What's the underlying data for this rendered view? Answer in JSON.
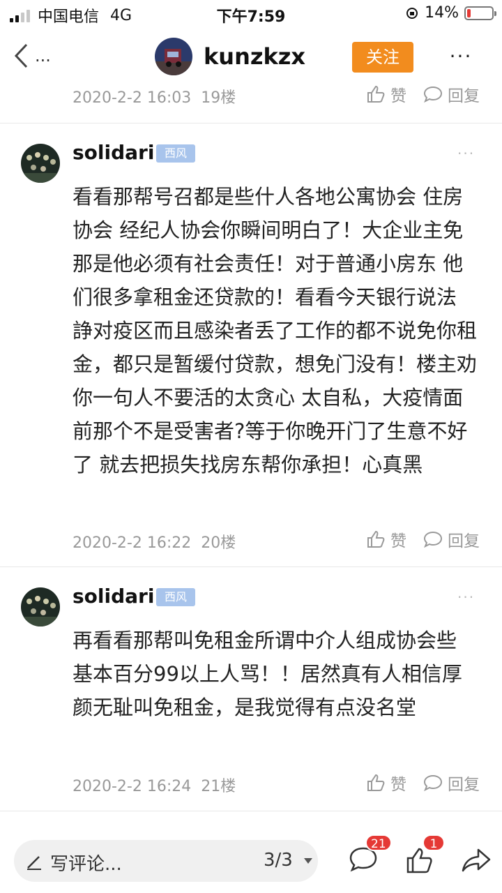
{
  "status_bar": {
    "carrier": "中国电信",
    "network": "4G",
    "time": "下午7:59",
    "battery": "14%",
    "battery_level": 0.14,
    "signal_bars": 2
  },
  "nav": {
    "username": "kunzkzx",
    "follow_label": "关注",
    "back_suffix": "...",
    "more_label": "···"
  },
  "posts": [
    {
      "meta": "2020-2-2 16:03",
      "floor": "19楼",
      "like_label": "赞",
      "reply_label": "回复"
    },
    {
      "user": "solidari",
      "tag": "西风",
      "more": "···",
      "text": "看看那帮号召都是些什人各地公寓协会 住房协会 经纪人协会你瞬间明白了！大企业主免那是他必须有社会责任！对于普通小房东 他们很多拿租金还贷款的！看看今天银行说法 諍对疫区而且感染者丢了工作的都不说免你租金，都只是暂缓付贷款，想免门没有！楼主劝你一句人不要活的太贪心 太自私，大疫情面前那个不是受害者?等于你晚开门了生意不好了 就去把损失找房东帮你承担！心真黑",
      "meta": "2020-2-2 16:22",
      "floor": "20楼",
      "like_label": "赞",
      "reply_label": "回复"
    },
    {
      "user": "solidari",
      "tag": "西风",
      "more": "···",
      "text": "再看看那帮叫免租金所谓中介人组成协会些 基本百分99以上人骂！！居然真有人相信厚颜无耻叫免租金，是我觉得有点没名堂",
      "meta": "2020-2-2 16:24",
      "floor": "21楼",
      "like_label": "赞",
      "reply_label": "回复"
    }
  ],
  "bottom_bar": {
    "write_placeholder": "写评论...",
    "page_indicator": "3/3",
    "comment_count": "21",
    "like_count": "1"
  },
  "colors": {
    "accent": "#f28c1e",
    "badge": "#e53935",
    "tag": "#a8c4ec",
    "meta_text": "#999999"
  }
}
